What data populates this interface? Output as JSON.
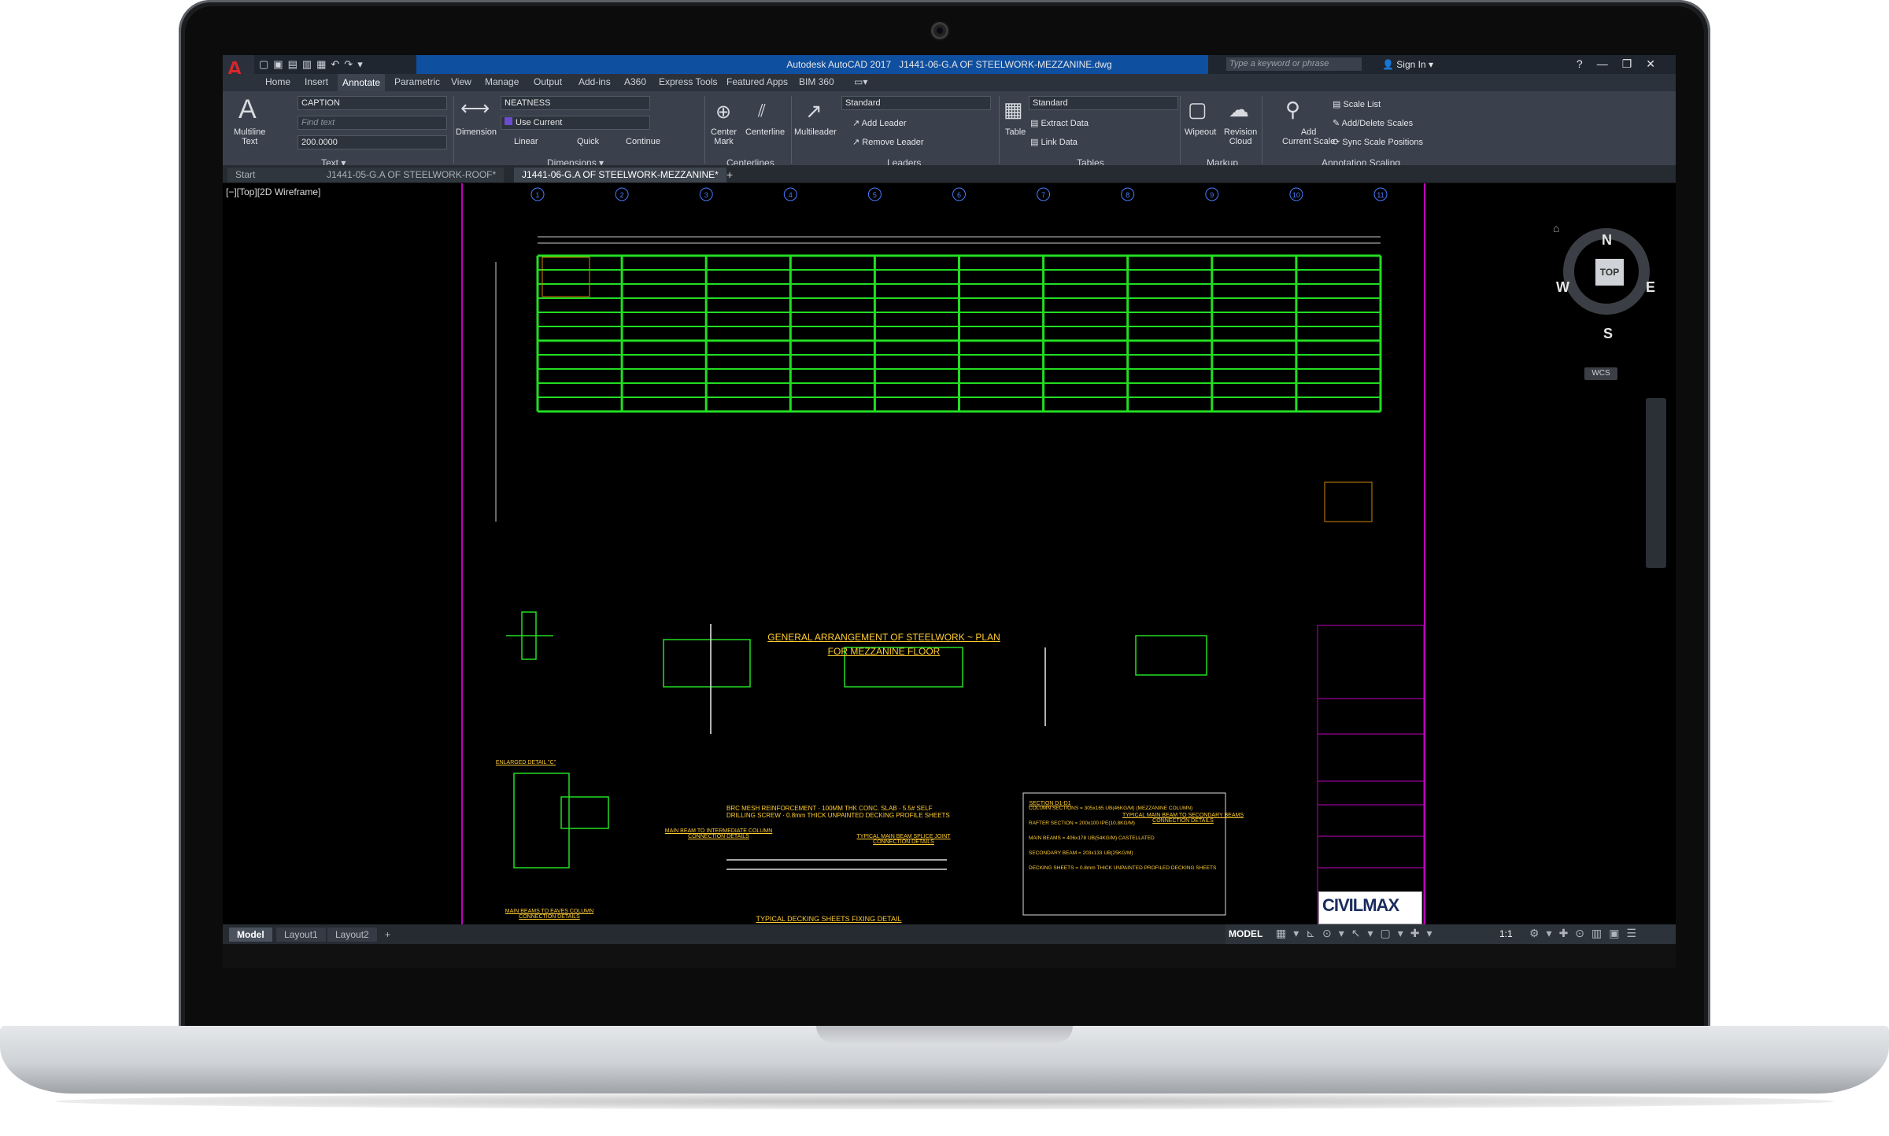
{
  "window": {
    "app_title": "Autodesk AutoCAD 2017",
    "file_title": "J1441-06-G.A OF STEELWORK-MEZZANINE.dwg",
    "search_placeholder": "Type a keyword or phrase",
    "sign_in": "Sign In"
  },
  "ribbon_tabs": [
    "Home",
    "Insert",
    "Annotate",
    "Parametric",
    "View",
    "Manage",
    "Output",
    "Add-ins",
    "A360",
    "Express Tools",
    "Featured Apps",
    "BIM 360"
  ],
  "ribbon": {
    "text_group": {
      "multiline_text": "Multiline\nText",
      "text_style": "CAPTION",
      "find_text_placeholder": "Find text",
      "text_height": "200.0000",
      "label": "Text"
    },
    "dimensions_group": {
      "dimension": "Dimension",
      "dim_style": "NEATNESS",
      "use_current": "Use Current",
      "linear": "Linear",
      "quick": "Quick",
      "continue": "Continue",
      "label": "Dimensions"
    },
    "centerlines_group": {
      "center_mark": "Center\nMark",
      "centerline": "Centerline",
      "label": "Centerlines"
    },
    "leaders_group": {
      "multileader": "Multileader",
      "style": "Standard",
      "add_leader": "Add Leader",
      "remove_leader": "Remove Leader",
      "label": "Leaders"
    },
    "tables_group": {
      "table": "Table",
      "style": "Standard",
      "extract_data": "Extract Data",
      "link_data": "Link Data",
      "label": "Tables"
    },
    "markup_group": {
      "wipeout": "Wipeout",
      "revision_cloud": "Revision\nCloud",
      "label": "Markup"
    },
    "annotation_scaling_group": {
      "add_current_scale": "Add\nCurrent Scale",
      "scale_list": "Scale List",
      "add_delete_scales": "Add/Delete Scales",
      "sync_scale_positions": "Sync Scale Positions",
      "label": "Annotation Scaling"
    }
  },
  "doc_tabs": [
    "Start",
    "J1441-05-G.A OF STEELWORK-ROOF*",
    "J1441-06-G.A OF STEELWORK-MEZZANINE*"
  ],
  "viewport_label": "[−][Top][2D Wireframe]",
  "viewcube": {
    "top": "TOP",
    "n": "N",
    "s": "S",
    "e": "E",
    "w": "W",
    "wcs": "WCS"
  },
  "drawing": {
    "grid_numbers": [
      "1",
      "2",
      "3",
      "4",
      "5",
      "6",
      "7",
      "8",
      "9",
      "10",
      "11"
    ],
    "plan_title": "GENERAL ARRANGEMENT OF STEELWORK ~ PLAN",
    "plan_title2": "FOR MEZZANINE FLOOR",
    "details": [
      "ENLARGED DETAIL \"C\"",
      "MAIN BEAM TO INTERMEDIATE COLUMN CONNECTION DETAILS",
      "TYPICAL MAIN BEAM SPLICE JOINT CONNECTION DETAILS",
      "SECTION D1-D1",
      "TYPICAL MAIN BEAM TO SECONDARY BEAMS CONNECTION DETAILS",
      "MAIN BEAMS TO EAVES COLUMN CONNECTION DETAILS",
      "TYPICAL DECKING SHEETS FIXING DETAIL"
    ],
    "decking_notes": [
      "BRC MESH REINFORCEMENT",
      "100MM THK CONC. SLAB",
      "5.5# SELF DRILLING SCREW",
      "0.8mm THICK UNPAINTED DECKING PROFILE SHEETS"
    ],
    "section_sizes": [
      "COLUMN SECTIONS  = 305x165 UB(46KG/M) (MEZZANINE COLUMN)",
      "RAFTER SECTION  = 200x100 IPE(10.8KG/M)",
      "MAIN BEAMS  = 406x178 UB(54KG/M) CASTELLATED",
      "SECONDARY BEAM  = 203x133 UB(25KG/M)",
      "DECKING SHEETS  = 0.8mm THICK UNPAINTED PROFILED DECKING SHEETS"
    ],
    "logo": "CIVILMAX"
  },
  "layout_tabs": [
    "Model",
    "Layout1",
    "Layout2"
  ],
  "status": {
    "model": "MODEL",
    "scale": "1:1"
  }
}
